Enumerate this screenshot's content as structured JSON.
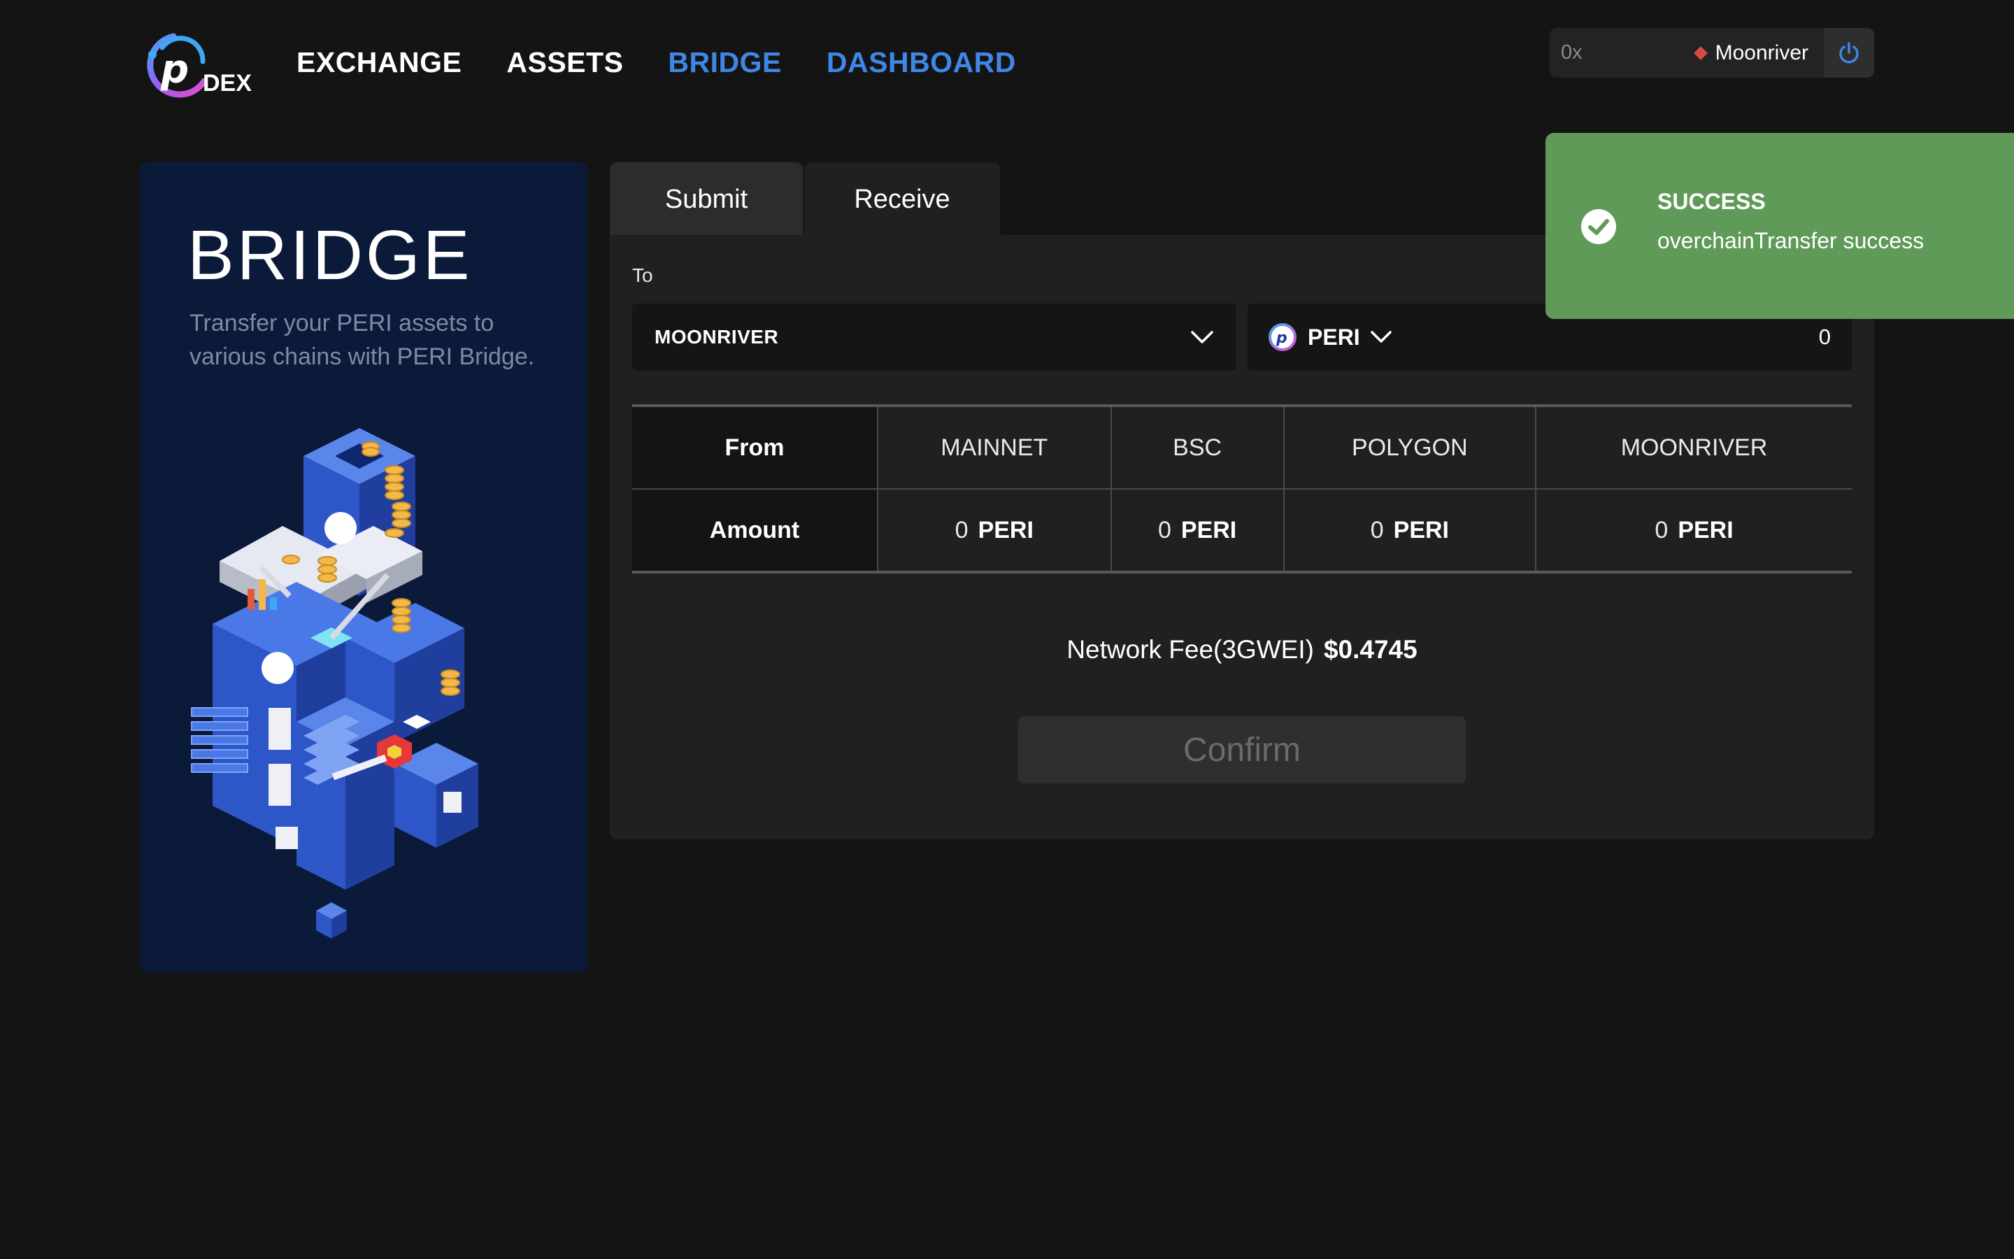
{
  "header": {
    "logo_text": "DEX",
    "nav": [
      {
        "label": "EXCHANGE",
        "color": "#ffffff"
      },
      {
        "label": "ASSETS",
        "color": "#ffffff"
      },
      {
        "label": "BRIDGE",
        "color": "#3f87e6"
      },
      {
        "label": "DASHBOARD",
        "color": "#3f87e6"
      }
    ],
    "wallet": {
      "address": "0x",
      "network": "Moonriver",
      "power_icon": "power-icon"
    }
  },
  "side": {
    "title": "BRIDGE",
    "description": "Transfer your PERI assets to various chains with PERI Bridge."
  },
  "tabs": {
    "submit": "Submit",
    "receive": "Receive",
    "active": "receive"
  },
  "form": {
    "to_label": "To",
    "destination": "MOONRIVER",
    "token": "PERI",
    "amount": "0"
  },
  "table": {
    "from_label": "From",
    "amount_label": "Amount",
    "chains": [
      {
        "name": "MAINNET",
        "amount": "0",
        "unit": "PERI"
      },
      {
        "name": "BSC",
        "amount": "0",
        "unit": "PERI"
      },
      {
        "name": "POLYGON",
        "amount": "0",
        "unit": "PERI"
      },
      {
        "name": "MOONRIVER",
        "amount": "0",
        "unit": "PERI"
      }
    ]
  },
  "fee": {
    "label": "Network Fee(3GWEI)",
    "value": "$0.4745"
  },
  "confirm_label": "Confirm",
  "toast": {
    "title": "SUCCESS",
    "message": "overchainTransfer success",
    "color": "#5f9a59"
  },
  "colors": {
    "accent": "#3f87e6",
    "background": "#141414",
    "panel": "#0c1a3a"
  }
}
